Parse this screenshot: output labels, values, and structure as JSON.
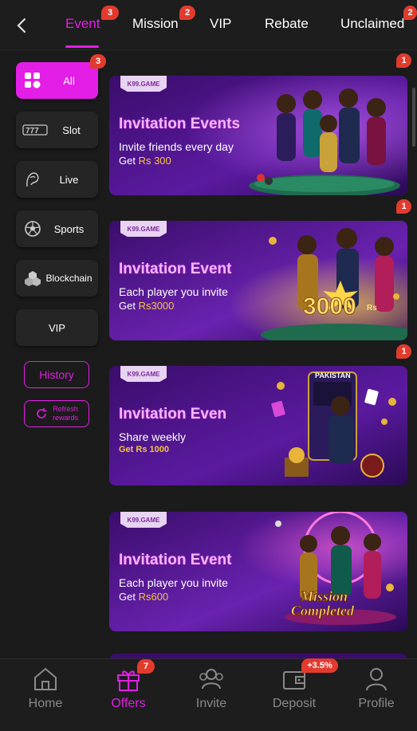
{
  "header": {
    "tabs": [
      {
        "label": "Event",
        "badge": "3",
        "active": true
      },
      {
        "label": "Mission",
        "badge": "2"
      },
      {
        "label": "VIP"
      },
      {
        "label": "Rebate"
      },
      {
        "label": "Unclaimed",
        "badge": "2"
      }
    ]
  },
  "sidebar": {
    "items": [
      {
        "label": "All",
        "icon": "grid-icon",
        "badge": "3",
        "active": true
      },
      {
        "label": "Slot",
        "icon": "slot-777-icon"
      },
      {
        "label": "Live",
        "icon": "dealer-icon"
      },
      {
        "label": "Sports",
        "icon": "soccer-ball-icon"
      },
      {
        "label": "Blockchain",
        "icon": "blockchain-icon"
      },
      {
        "label": "VIP"
      }
    ],
    "history_label": "History",
    "refresh_label_1": "Refresh",
    "refresh_label_2": "rewards"
  },
  "banners": [
    {
      "brand": "K99.GAME",
      "title": "Invitation Events",
      "line1": "Invite friends every day",
      "line2_prefix": "Get ",
      "amount": "Rs 300",
      "badge": "1"
    },
    {
      "brand": "K99.GAME",
      "title": "Invitation Event",
      "line1": "Each player you invite",
      "line2_prefix": "Get ",
      "amount": "Rs3000",
      "badge": "1",
      "art_text": "3000",
      "art_sub": "Rs"
    },
    {
      "brand": "K99.GAME",
      "title": "Invitation Even",
      "line1": "Share weekly",
      "line2_prefix": "",
      "amount": "Get Rs 1000",
      "badge": "1",
      "art_text": "PAKISTAN"
    },
    {
      "brand": "K99.GAME",
      "title": "Invitation Event",
      "line1": "Each player you invite",
      "line2_prefix": "Get ",
      "amount": "Rs600",
      "art_text_1": "Mission",
      "art_text_2": "Completed"
    }
  ],
  "bottom_nav": {
    "items": [
      {
        "label": "Home",
        "icon": "home-icon"
      },
      {
        "label": "Offers",
        "icon": "gift-icon",
        "badge": "7",
        "active": true
      },
      {
        "label": "Invite",
        "icon": "invite-people-icon"
      },
      {
        "label": "Deposit",
        "icon": "wallet-icon",
        "badge": "+3.5%"
      },
      {
        "label": "Profile",
        "icon": "profile-icon"
      }
    ]
  },
  "colors": {
    "accent": "#e31ee6",
    "badge": "#e23b2e",
    "background": "#1b1b1b",
    "amount": "#f5c542"
  }
}
